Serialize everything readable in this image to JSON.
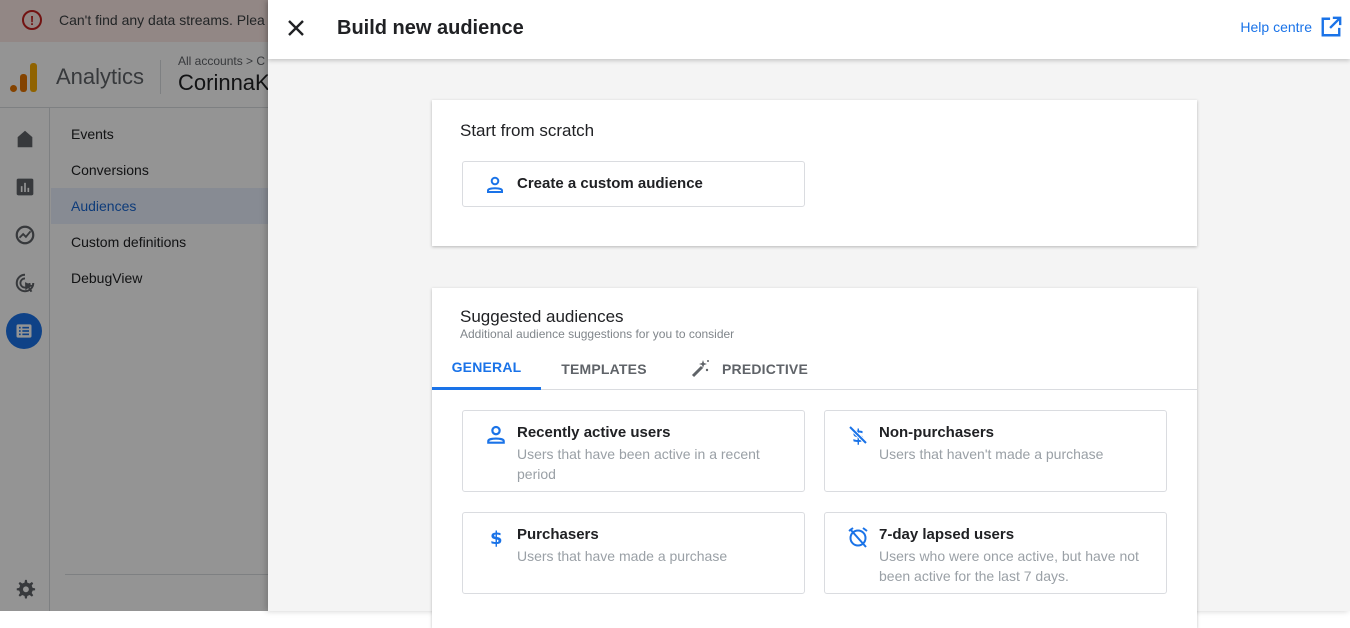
{
  "banner": {
    "icon": "error-icon",
    "message": "Can't find any data streams. Plea"
  },
  "app": {
    "name": "Analytics",
    "breadcrumb": "All accounts > C",
    "account_name": "CorinnaK"
  },
  "rail": {
    "items": [
      {
        "name": "home-icon"
      },
      {
        "name": "reports-icon"
      },
      {
        "name": "explore-icon"
      },
      {
        "name": "advertising-icon"
      },
      {
        "name": "configure-icon",
        "active": true
      }
    ],
    "settings_icon": "gear-icon"
  },
  "nav": {
    "items": [
      {
        "label": "Events"
      },
      {
        "label": "Conversions"
      },
      {
        "label": "Audiences",
        "active": true
      },
      {
        "label": "Custom definitions"
      },
      {
        "label": "DebugView"
      }
    ]
  },
  "panel": {
    "title": "Build new audience",
    "close_icon": "close-icon",
    "help_label": "Help centre",
    "help_icon": "open-in-new-icon"
  },
  "scratch": {
    "title": "Start from scratch",
    "custom_label": "Create a custom audience"
  },
  "suggested": {
    "title": "Suggested audiences",
    "subtitle": "Additional audience suggestions for you to consider",
    "tabs": [
      {
        "label": "GENERAL",
        "active": true
      },
      {
        "label": "TEMPLATES"
      },
      {
        "label": "PREDICTIVE",
        "icon": "magic-wand-icon"
      }
    ],
    "options": [
      {
        "title": "Recently active users",
        "desc": "Users that have been active in a recent period",
        "icon": "person-icon"
      },
      {
        "title": "Non-purchasers",
        "desc": "Users that haven't made a purchase",
        "icon": "money-off-icon"
      },
      {
        "title": "Purchasers",
        "desc": "Users that have made a purchase",
        "icon": "dollar-icon"
      },
      {
        "title": "7-day lapsed users",
        "desc": "Users who were once active, but have not been active for the last 7 days.",
        "icon": "alarm-off-icon"
      }
    ]
  },
  "colors": {
    "accent": "#1a73e8",
    "error": "#c5221f",
    "logo_orange": "#e37400",
    "logo_yellow": "#f9ab00"
  }
}
